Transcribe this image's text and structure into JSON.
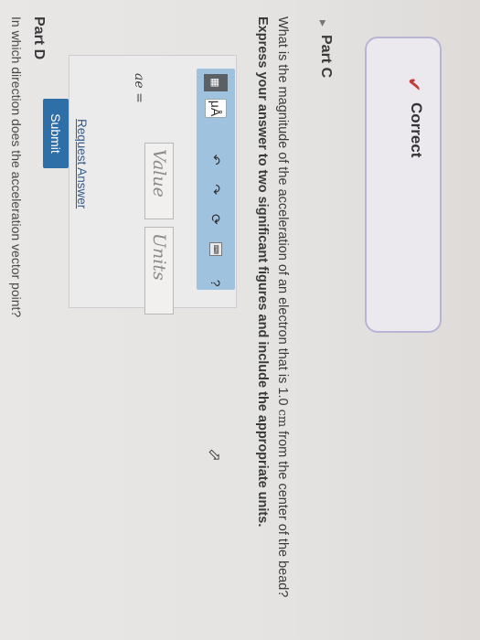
{
  "status": {
    "correct_label": "Correct"
  },
  "part_c": {
    "title": "Part C",
    "question_prefix": "What is the magnitude of the acceleration of an electron that is 1.0 ",
    "question_unit": "cm",
    "question_suffix": " from the center of the bead?",
    "instruction": "Express your answer to two significant figures and include the appropriate units.",
    "toolbar": {
      "template_icon": "template-icon",
      "units_label": "μÅ",
      "undo_icon": "undo-icon",
      "redo_icon": "redo-icon",
      "reset_icon": "reset-icon",
      "keyboard_icon": "keyboard-icon",
      "help_label": "?"
    },
    "variable_label": "ae =",
    "value_placeholder": "Value",
    "units_placeholder": "Units",
    "submit_label": "Submit",
    "request_answer_label": "Request Answer"
  },
  "part_d": {
    "title": "Part D",
    "question": "In which direction does the acceleration vector point?"
  },
  "colors": {
    "submit": "#2f6fa8",
    "toolbar": "#9fc2de",
    "link": "#345c8b"
  }
}
